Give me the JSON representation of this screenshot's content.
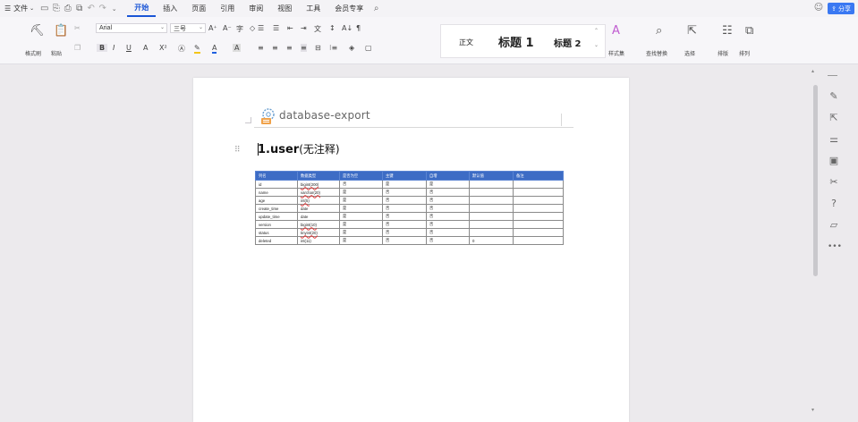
{
  "menu": {
    "file_label": "文件",
    "tabs": [
      "开始",
      "插入",
      "页面",
      "引用",
      "审阅",
      "视图",
      "工具",
      "会员专享"
    ],
    "active_tab": "开始",
    "share_label": "分享"
  },
  "ribbon": {
    "format_painter_label": "格式刷",
    "paste_label": "粘贴",
    "font_name": "Arial",
    "font_size": "三号",
    "styles": [
      {
        "label": "正文"
      },
      {
        "label": "标题 1"
      },
      {
        "label": "标题 2"
      }
    ],
    "style_set_label": "样式集",
    "find_replace_label": "查找替换",
    "select_label": "选择",
    "layout_label": "排版",
    "arrange_label": "排列"
  },
  "document": {
    "header_title": "database-export",
    "heading_main": "1.user",
    "heading_note": "(无注释)",
    "table": {
      "columns": [
        "列名",
        "数据类型",
        "是否为空",
        "主键",
        "自增",
        "默认值",
        "备注"
      ],
      "rows": [
        [
          "id",
          "bigint(200)",
          "否",
          "是",
          "是",
          "",
          ""
        ],
        [
          "name",
          "varchar(20)",
          "是",
          "否",
          "否",
          "",
          ""
        ],
        [
          "age",
          "int(5)",
          "是",
          "否",
          "否",
          "",
          ""
        ],
        [
          "create_time",
          "date",
          "是",
          "否",
          "否",
          "",
          ""
        ],
        [
          "update_time",
          "date",
          "是",
          "否",
          "否",
          "",
          ""
        ],
        [
          "version",
          "bigint(10)",
          "是",
          "否",
          "否",
          "",
          ""
        ],
        [
          "status",
          "tinyint(20)",
          "是",
          "否",
          "否",
          "",
          ""
        ],
        [
          "deleted",
          "int(11)",
          "是",
          "否",
          "否",
          "0",
          ""
        ]
      ],
      "underlined_type_rows": [
        0,
        1,
        2,
        5,
        6
      ]
    }
  },
  "side_tools": [
    "pen-icon",
    "cursor-select-icon",
    "filter-settings-icon",
    "image-edit-icon",
    "tools-icon",
    "help-icon",
    "comment-icon",
    "more-icon"
  ]
}
